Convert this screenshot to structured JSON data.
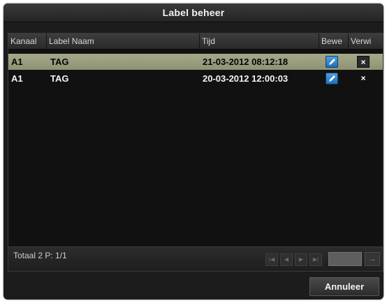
{
  "window": {
    "title": "Label beheer"
  },
  "table": {
    "columns": [
      "Kanaal",
      "Label Naam",
      "Tijd",
      "Bewe",
      "Verwi"
    ],
    "rows": [
      {
        "channel": "A1",
        "label": "TAG",
        "time": "21-03-2012 08:12:18",
        "edit_icon": "pencil-icon",
        "delete_label": "×",
        "selected": true
      },
      {
        "channel": "A1",
        "label": "TAG",
        "time": "20-03-2012 12:00:03",
        "edit_icon": "pencil-icon",
        "delete_label": "×",
        "selected": false
      }
    ]
  },
  "footer": {
    "summary": "Totaal 2 P: 1/1",
    "pagination": {
      "first_icon": "first-page-icon",
      "prev_icon": "prev-page-icon",
      "next_icon": "next-page-icon",
      "last_icon": "last-page-icon",
      "page_value": "",
      "go_label": "→"
    }
  },
  "buttons": {
    "cancel": "Annuleer"
  },
  "colors": {
    "selected_row": "#9c9e80",
    "edit_button": "#2f84cc",
    "window_bg": "#1c1c1c"
  }
}
